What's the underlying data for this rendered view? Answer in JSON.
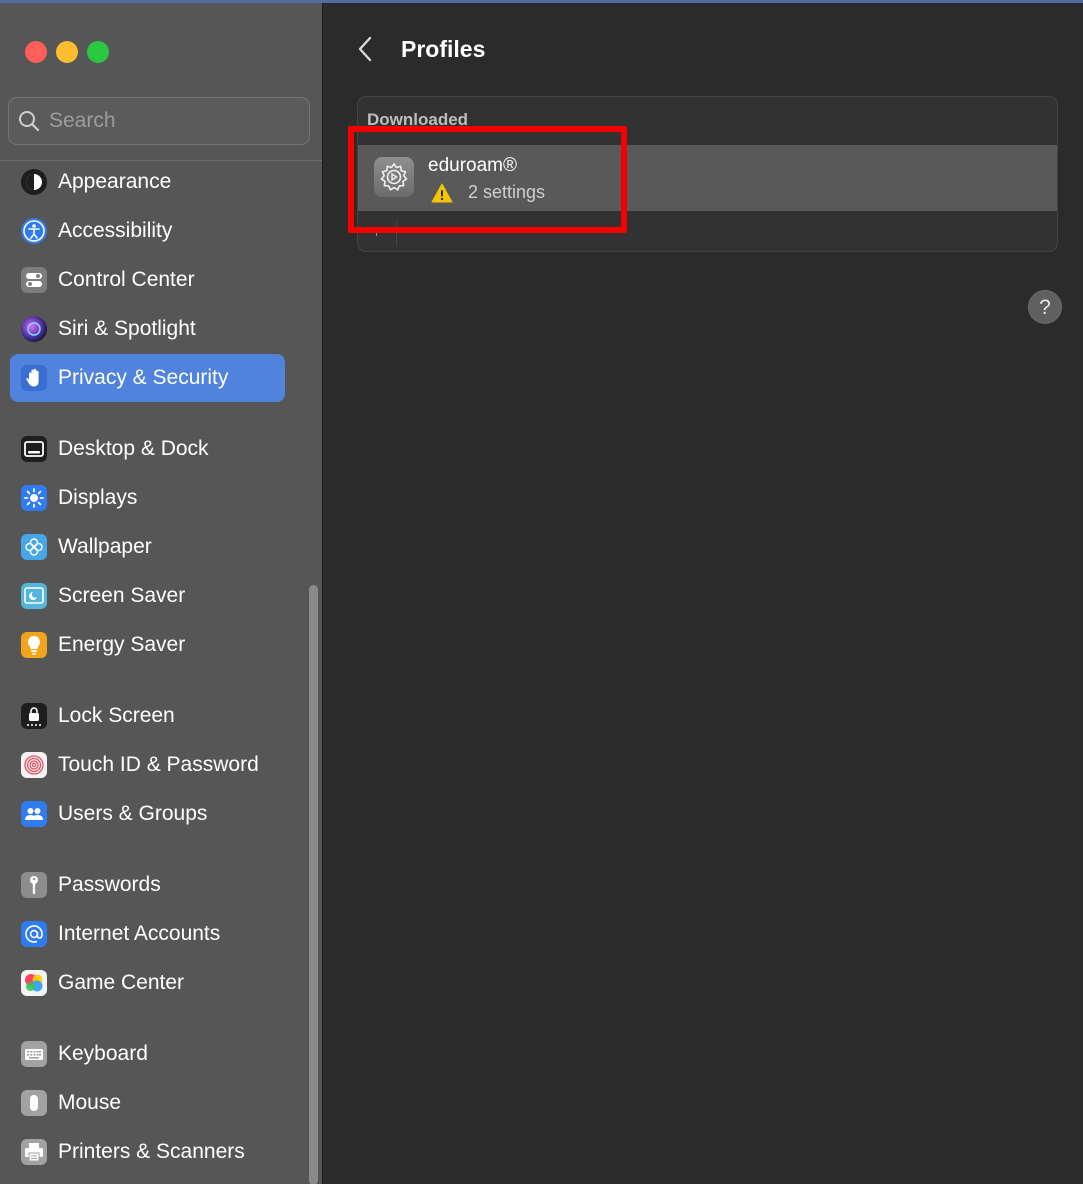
{
  "search": {
    "placeholder": "Search"
  },
  "sidebar": {
    "items": [
      {
        "label": "Appearance",
        "icon": "appearance-icon"
      },
      {
        "label": "Accessibility",
        "icon": "accessibility-icon"
      },
      {
        "label": "Control Center",
        "icon": "control-center-icon"
      },
      {
        "label": "Siri & Spotlight",
        "icon": "siri-icon"
      },
      {
        "label": "Privacy & Security",
        "icon": "privacy-hand-icon",
        "selected": true
      },
      {
        "label": "Desktop & Dock",
        "icon": "desktop-dock-icon"
      },
      {
        "label": "Displays",
        "icon": "displays-sun-icon"
      },
      {
        "label": "Wallpaper",
        "icon": "wallpaper-flower-icon"
      },
      {
        "label": "Screen Saver",
        "icon": "screen-saver-icon"
      },
      {
        "label": "Energy Saver",
        "icon": "energy-bulb-icon"
      },
      {
        "label": "Lock Screen",
        "icon": "lock-screen-icon"
      },
      {
        "label": "Touch ID & Password",
        "icon": "fingerprint-icon"
      },
      {
        "label": "Users & Groups",
        "icon": "users-icon"
      },
      {
        "label": "Passwords",
        "icon": "key-icon"
      },
      {
        "label": "Internet Accounts",
        "icon": "at-sign-icon"
      },
      {
        "label": "Game Center",
        "icon": "game-center-icon"
      },
      {
        "label": "Keyboard",
        "icon": "keyboard-icon"
      },
      {
        "label": "Mouse",
        "icon": "mouse-icon"
      },
      {
        "label": "Printers & Scanners",
        "icon": "printer-icon"
      }
    ]
  },
  "main": {
    "title": "Profiles",
    "section_header": "Downloaded",
    "profile": {
      "name": "eduroam®",
      "settings_count": "2 settings",
      "icon": "settings-gear-icon"
    },
    "help_label": "?"
  },
  "colors": {
    "accent": "#4f83dd",
    "highlight": "#f40000",
    "warning": "#f5c400"
  }
}
